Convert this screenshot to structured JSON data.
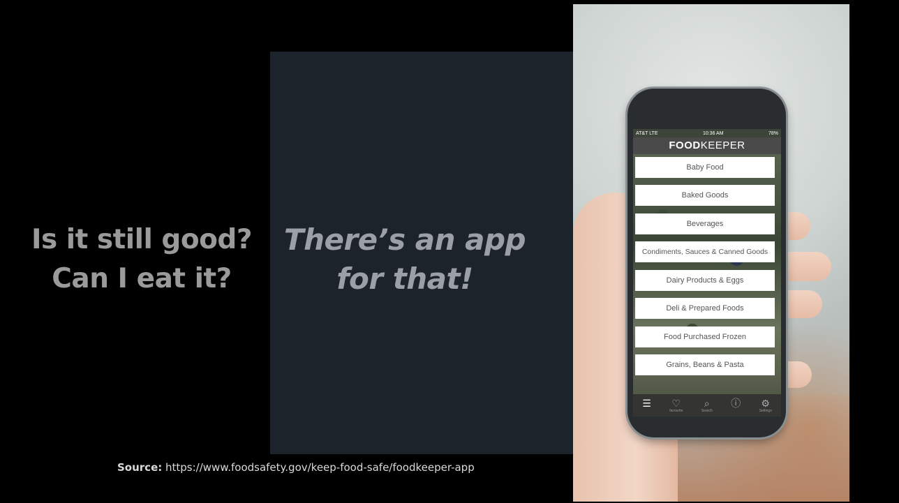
{
  "slide": {
    "left_text": [
      "Is it still good?",
      "Can I eat it?"
    ],
    "center_text": [
      "There’s an app",
      "for that!"
    ],
    "source_label": "Source:",
    "source_url": " https://www.foodsafety.gov/keep-food-safe/foodkeeper-app"
  },
  "phone": {
    "status": {
      "carrier": "AT&T  LTE",
      "time": "10:36 AM",
      "battery": "78%"
    },
    "app_title_bold": "FOOD",
    "app_title_light": "KEEPER",
    "menu": [
      "Baby Food",
      "Baked Goods",
      "Beverages",
      "Condiments, Sauces & Canned Goods",
      "Dairy Products & Eggs",
      "Deli & Prepared Foods",
      "Food Purchased Frozen",
      "Grains, Beans & Pasta"
    ],
    "tabs": [
      {
        "icon": "menu-icon",
        "glyph": "☰",
        "label": ""
      },
      {
        "icon": "heart-icon",
        "glyph": "♡",
        "label": "favourite"
      },
      {
        "icon": "search-icon",
        "glyph": "⌕",
        "label": "Search"
      },
      {
        "icon": "info-icon",
        "glyph": "ⓘ",
        "label": ""
      },
      {
        "icon": "gear-icon",
        "glyph": "⚙",
        "label": "Settings"
      }
    ]
  },
  "colors": {
    "background": "#000000",
    "panel": "#1d232b",
    "text_gray": "#9a9a9a",
    "app_header": "#4a4a4a"
  }
}
